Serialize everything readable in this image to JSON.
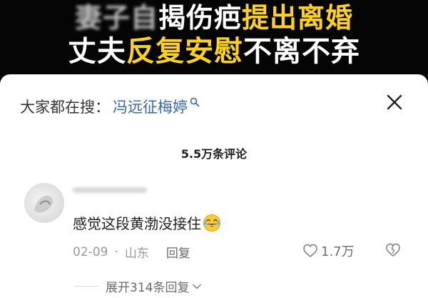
{
  "banner": {
    "line1_blurred": "妻子自",
    "line1_white": "揭伤疤",
    "line1_yellow": "提出离婚",
    "line2_white_a": "丈夫",
    "line2_yellow": "反复安慰",
    "line2_white_b": "不离不弃"
  },
  "search": {
    "prefix": "大家都在搜：",
    "term": "冯远征梅婷"
  },
  "comments": {
    "count_label": "5.5万条评论"
  },
  "comment": {
    "text": "感觉这段黄渤没接住",
    "date": "02-09",
    "dot": "·",
    "location": "山东",
    "reply_label": "回复",
    "like_count": "1.7万",
    "expand_label": "展开314条回复"
  },
  "icons": {
    "close": "close-icon",
    "search": "search-icon",
    "laugh": "laughing-emoji-icon",
    "like": "heart-icon",
    "dislike": "broken-heart-icon",
    "chevron": "chevron-down-icon"
  },
  "colors": {
    "caption_yellow": "#ffd21f",
    "search_link": "#3b66a8",
    "meta_gray": "#9a9a9a"
  }
}
